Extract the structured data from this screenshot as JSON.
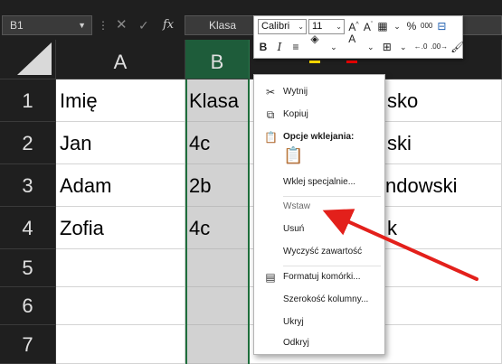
{
  "formula_bar": {
    "name_box": "B1",
    "formula_value": "Klasa",
    "fx_label": "fx"
  },
  "mini_toolbar": {
    "font_name": "Calibri",
    "font_size": "11",
    "percent": "%",
    "thousands": "000"
  },
  "sheet": {
    "columns": [
      "A",
      "B"
    ],
    "rows": [
      {
        "num": "1",
        "a": "Imię",
        "b": "Klasa",
        "c": "sko"
      },
      {
        "num": "2",
        "a": "Jan",
        "b": "4c",
        "c": "ski"
      },
      {
        "num": "3",
        "a": "Adam",
        "b": "2b",
        "c": "ndowski"
      },
      {
        "num": "4",
        "a": "Zofia",
        "b": "4c",
        "c": "k"
      },
      {
        "num": "5",
        "a": "",
        "b": "",
        "c": ""
      },
      {
        "num": "6",
        "a": "",
        "b": "",
        "c": ""
      },
      {
        "num": "7",
        "a": "",
        "b": "",
        "c": ""
      }
    ],
    "selected_column": "B"
  },
  "context_menu": {
    "cut": "Wytnij",
    "copy": "Kopiuj",
    "paste_options": "Opcje wklejania:",
    "paste_special": "Wklej specjalnie...",
    "insert": "Wstaw",
    "delete": "Usuń",
    "clear_contents": "Wyczyść zawartość",
    "format_cells": "Formatuj komórki...",
    "column_width": "Szerokość kolumny...",
    "hide": "Ukryj",
    "unhide": "Odkryj"
  },
  "colors": {
    "header_bg": "#1f1f1f",
    "selected_header_bg": "#1e5c3a",
    "selection_border": "#1e6e3c",
    "annotation_arrow": "#e3201b"
  }
}
